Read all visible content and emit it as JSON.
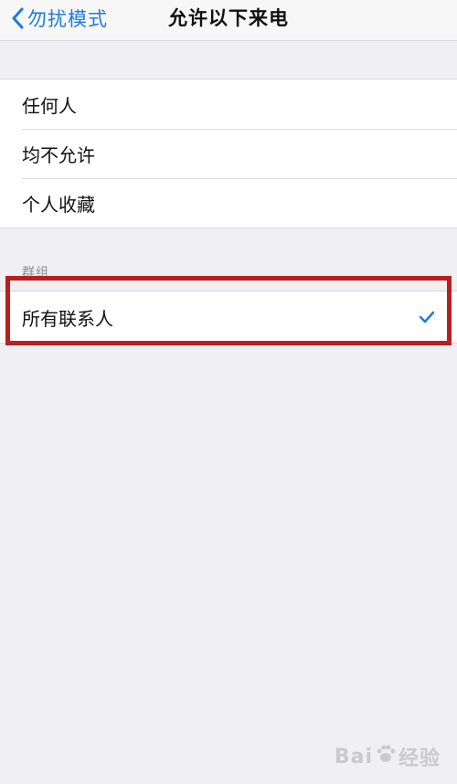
{
  "navbar": {
    "back_label": "勿扰模式",
    "title": "允许以下来电"
  },
  "options": [
    {
      "label": "任何人"
    },
    {
      "label": "均不允许"
    },
    {
      "label": "个人收藏"
    }
  ],
  "groups_section": {
    "header": "群组",
    "items": [
      {
        "label": "所有联系人",
        "selected": true
      }
    ]
  },
  "colors": {
    "accent": "#1f7ae0",
    "highlight": "#b81f1f",
    "background": "#efeff4"
  },
  "watermark": {
    "text_left": "Bai",
    "text_right": "经验"
  }
}
